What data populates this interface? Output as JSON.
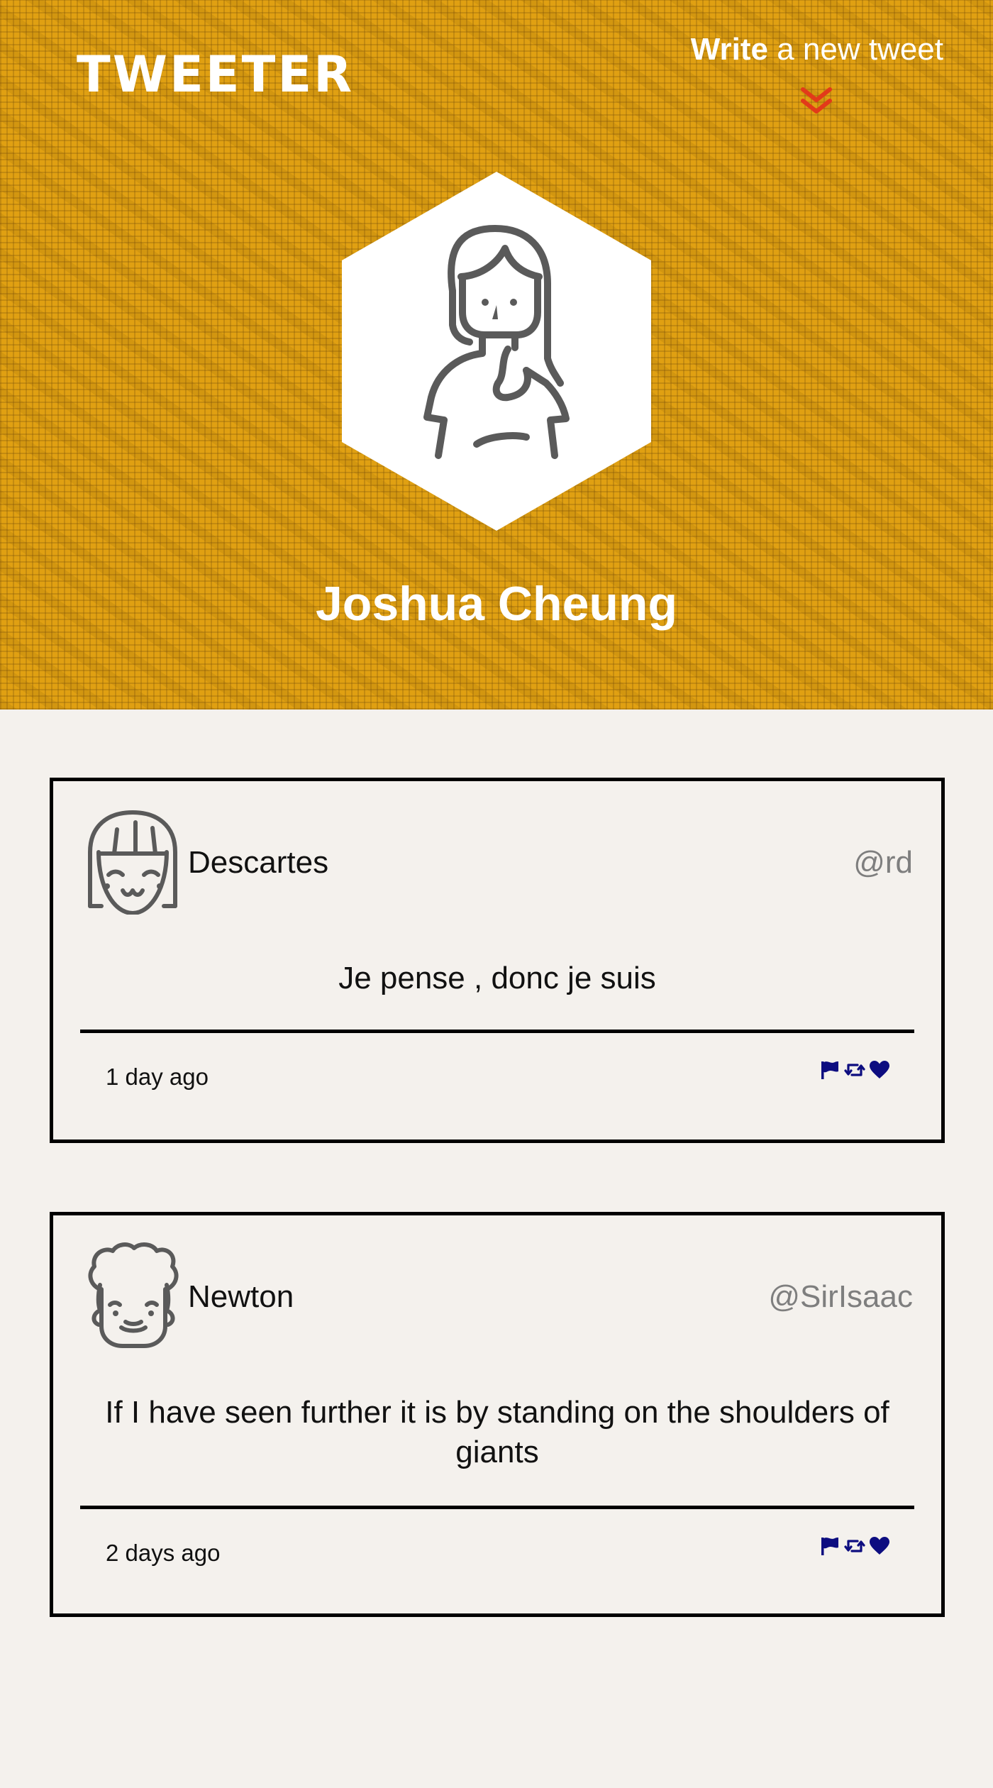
{
  "app": {
    "logo": "TWEETER"
  },
  "compose": {
    "bold": "Write",
    "rest": " a new tweet",
    "icon": "double-chevron-down-icon"
  },
  "profile": {
    "name": "Joshua Cheung",
    "avatar": "woman-avatar"
  },
  "colors": {
    "header_bg": "#e0a012",
    "page_bg": "#f4f1ed",
    "action_icons": "#0d0d80",
    "chevron": "#e23a1a",
    "handle": "#7e7e7e"
  },
  "tweets": [
    {
      "author": "Descartes",
      "handle": "@rd",
      "content": "Je pense , donc je suis",
      "time": "1 day ago",
      "avatar": "girl-bangs-avatar",
      "actions": [
        "flag-icon",
        "retweet-icon",
        "heart-icon"
      ]
    },
    {
      "author": "Newton",
      "handle": "@SirIsaac",
      "content": "If I have seen further it is by standing on the shoulders of giants",
      "time": "2 days ago",
      "avatar": "curly-hair-avatar",
      "actions": [
        "flag-icon",
        "retweet-icon",
        "heart-icon"
      ]
    }
  ]
}
